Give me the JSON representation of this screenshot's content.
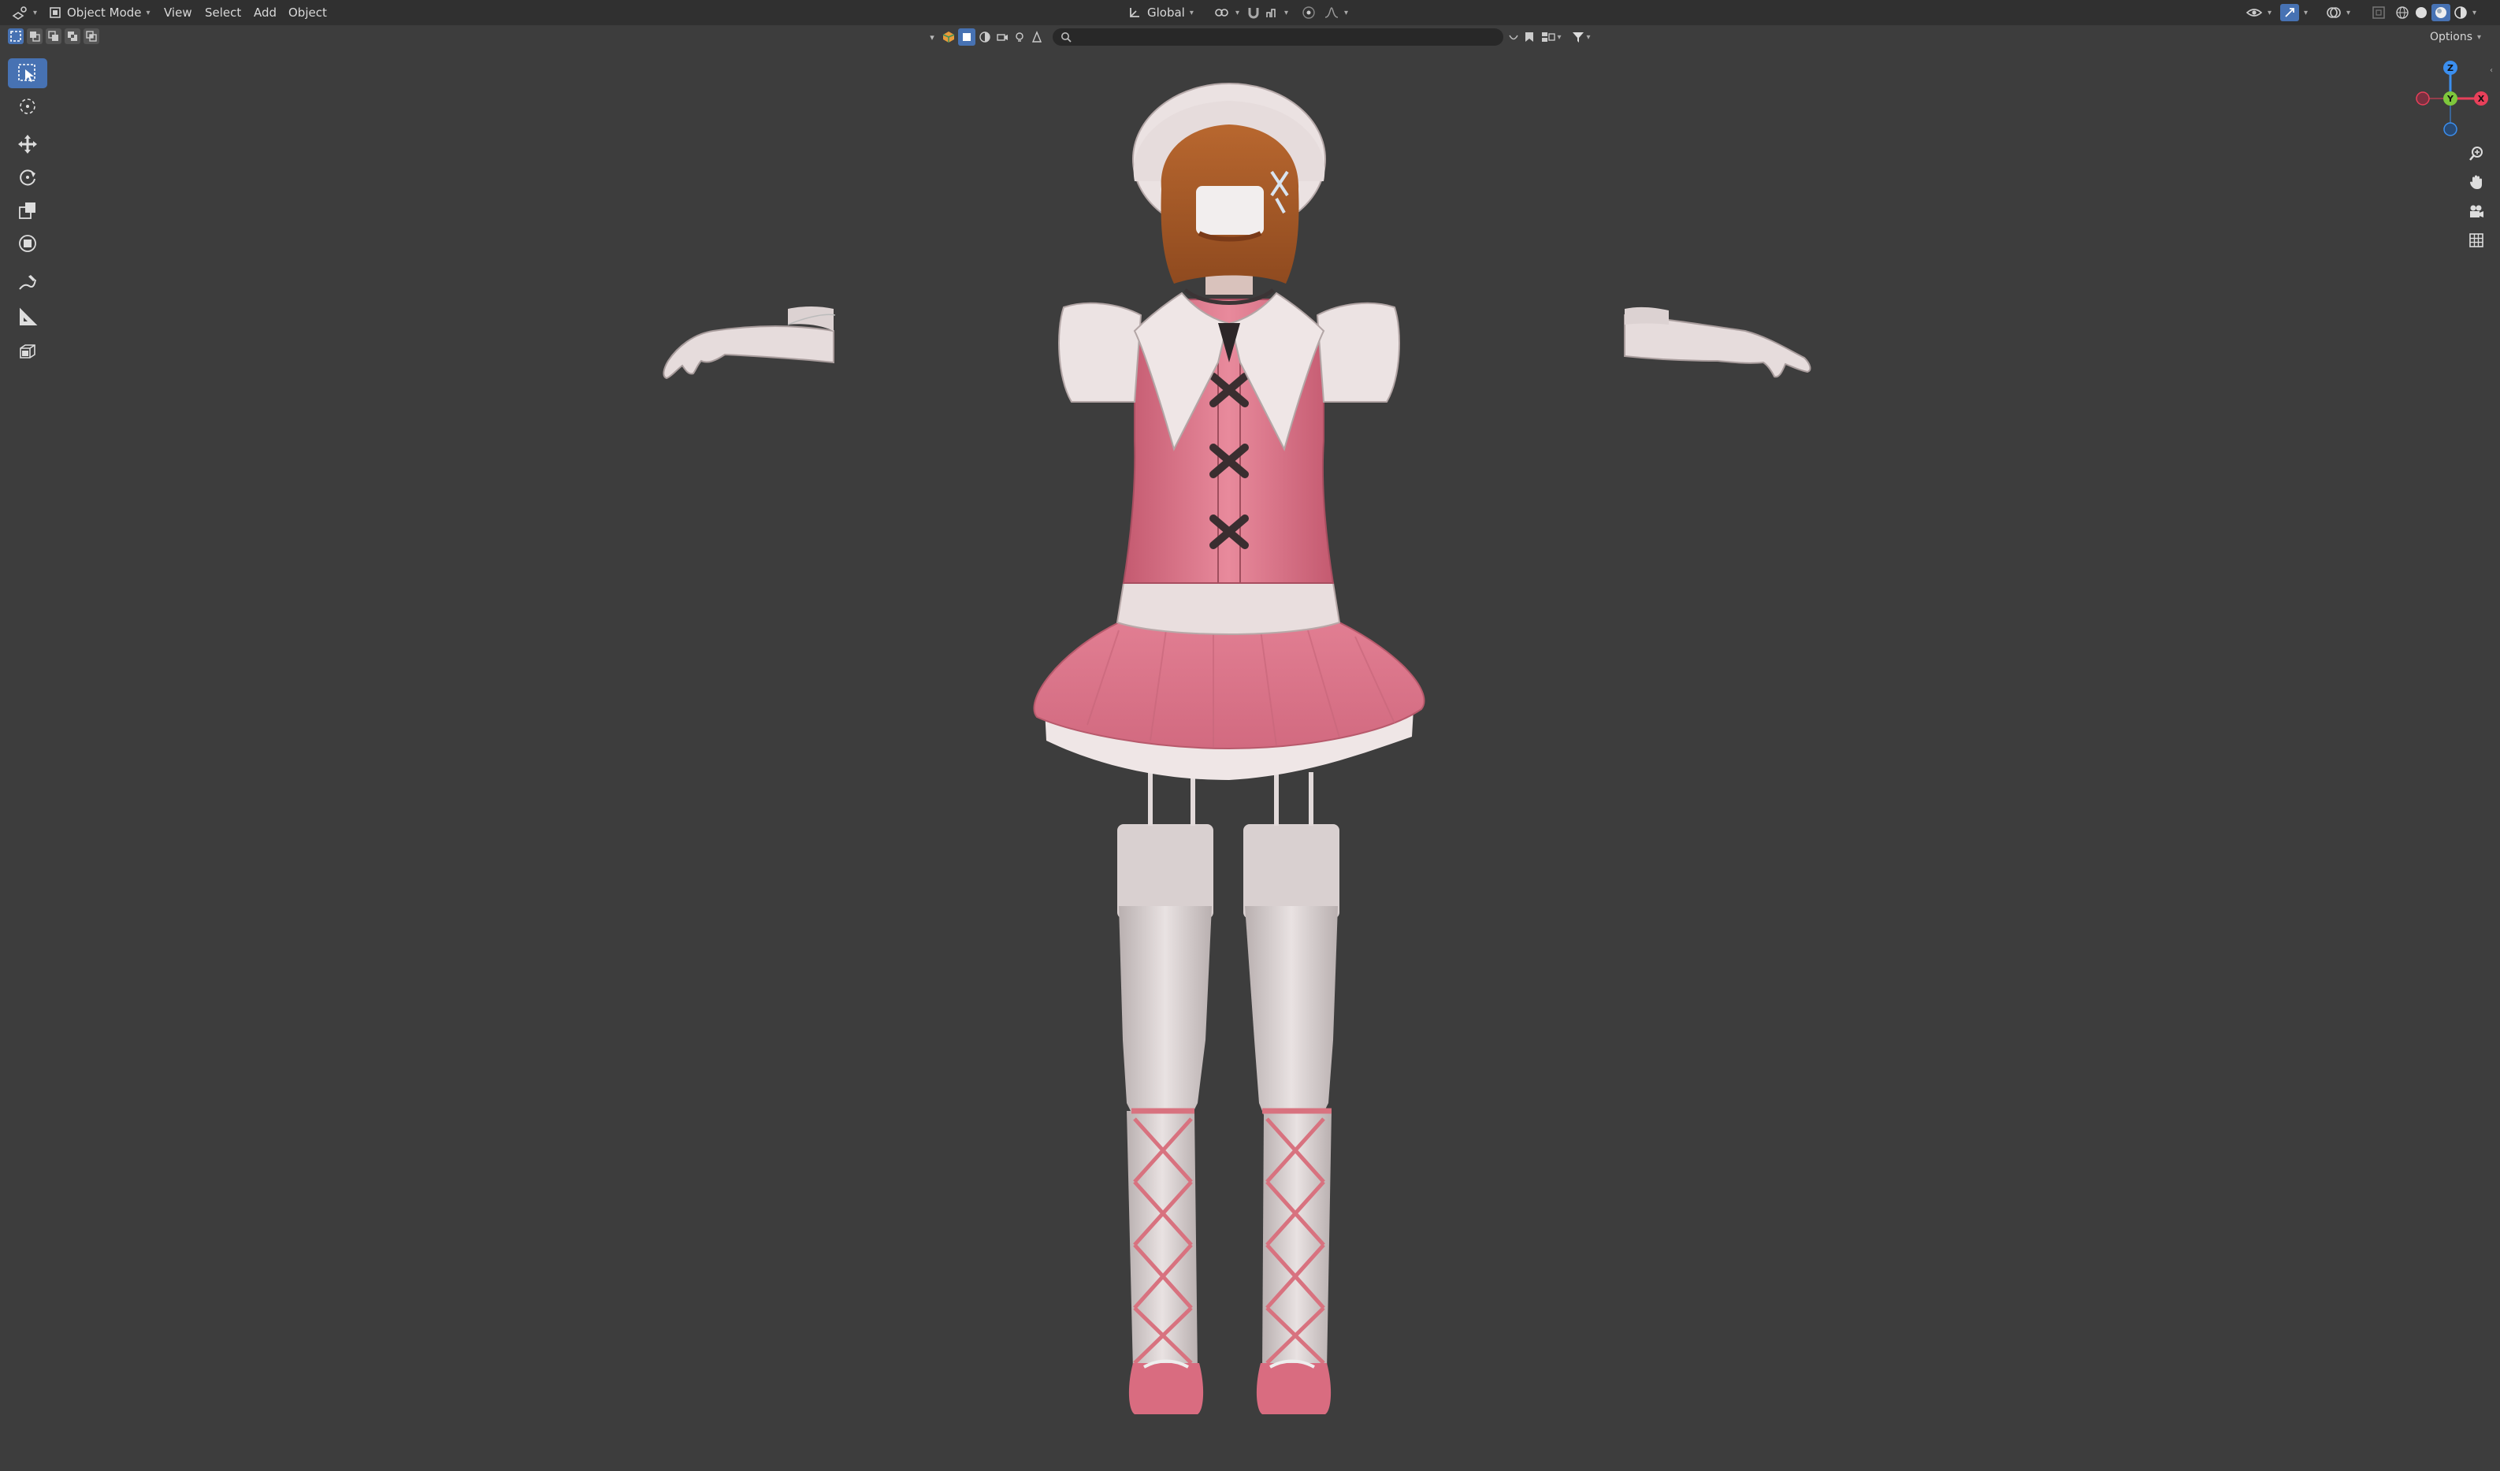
{
  "header": {
    "mode_label": "Object Mode",
    "menus": [
      "View",
      "Select",
      "Add",
      "Object"
    ],
    "orientation_label": "Global"
  },
  "viewport": {
    "options_label": "Options",
    "gizmo_axes": {
      "x": "X",
      "y": "Y",
      "z": "Z"
    }
  },
  "toolbar": {
    "tools": [
      "select-box",
      "cursor",
      "move",
      "rotate",
      "scale",
      "transform",
      "annotate",
      "measure",
      "add-cube"
    ],
    "active_tool": "select-box"
  },
  "colors": {
    "header_bg": "#303030",
    "viewport_bg": "#3d3d3d",
    "accent": "#4772b3",
    "axis_x": "#e8405a",
    "axis_y": "#7ec73c",
    "axis_z": "#3b8ff0"
  }
}
